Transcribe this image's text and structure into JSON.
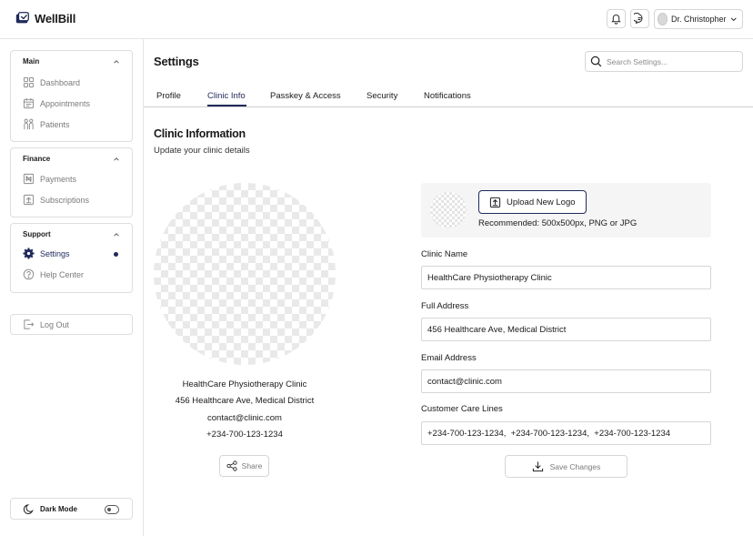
{
  "brand": {
    "name": "WellBill",
    "logo_icon": "wellbill-logo-icon"
  },
  "header": {
    "notification_icon": "bell-icon",
    "messages_icon": "chat-icon",
    "user": {
      "name": "Dr. Christopher"
    }
  },
  "sidebar": {
    "sections": [
      {
        "title": "Main",
        "items": [
          {
            "label": "Dashboard",
            "icon": "dashboard-icon"
          },
          {
            "label": "Appointments",
            "icon": "calendar-icon"
          },
          {
            "label": "Patients",
            "icon": "users-icon"
          }
        ]
      },
      {
        "title": "Finance",
        "items": [
          {
            "label": "Payments",
            "icon": "naira-icon"
          },
          {
            "label": "Subscriptions",
            "icon": "subscriptions-icon"
          }
        ]
      },
      {
        "title": "Support",
        "items": [
          {
            "label": "Settings",
            "icon": "gear-icon",
            "active": true
          },
          {
            "label": "Help Center",
            "icon": "help-icon"
          }
        ]
      }
    ],
    "logout_label": "Log Out",
    "dark_mode_label": "Dark Mode",
    "dark_mode_on": false
  },
  "main": {
    "title": "Settings",
    "search_placeholder": "Search Settings...",
    "tabs": [
      {
        "label": "Profile"
      },
      {
        "label": "Clinic Info",
        "active": true
      },
      {
        "label": "Passkey & Access"
      },
      {
        "label": "Security"
      },
      {
        "label": "Notifications"
      }
    ],
    "section_title": "Clinic Information",
    "section_subtitle": "Update your clinic details",
    "preview": {
      "name": "HealthCare Physiotherapy Clinic",
      "address": "456 Healthcare Ave, Medical District",
      "email": "contact@clinic.com",
      "phone": "+234-700-123-1234",
      "share_label": "Share"
    },
    "upload": {
      "button_label": "Upload New Logo",
      "hint": "Recommended: 500x500px, PNG or JPG"
    },
    "fields": [
      {
        "label": "Clinic Name",
        "value": "HealthCare Physiotherapy Clinic"
      },
      {
        "label": "Full Address",
        "value": "456 Healthcare Ave, Medical District"
      },
      {
        "label": "Email Address",
        "value": "contact@clinic.com"
      },
      {
        "label": "Customer Care Lines",
        "value": "+234-700-123-1234,  +234-700-123-1234,  +234-700-123-1234"
      }
    ],
    "save_label": "Save Changes"
  },
  "colors": {
    "accent": "#1f2a5a",
    "border": "#d6d6d6",
    "muted_text": "#7a7a7a"
  }
}
